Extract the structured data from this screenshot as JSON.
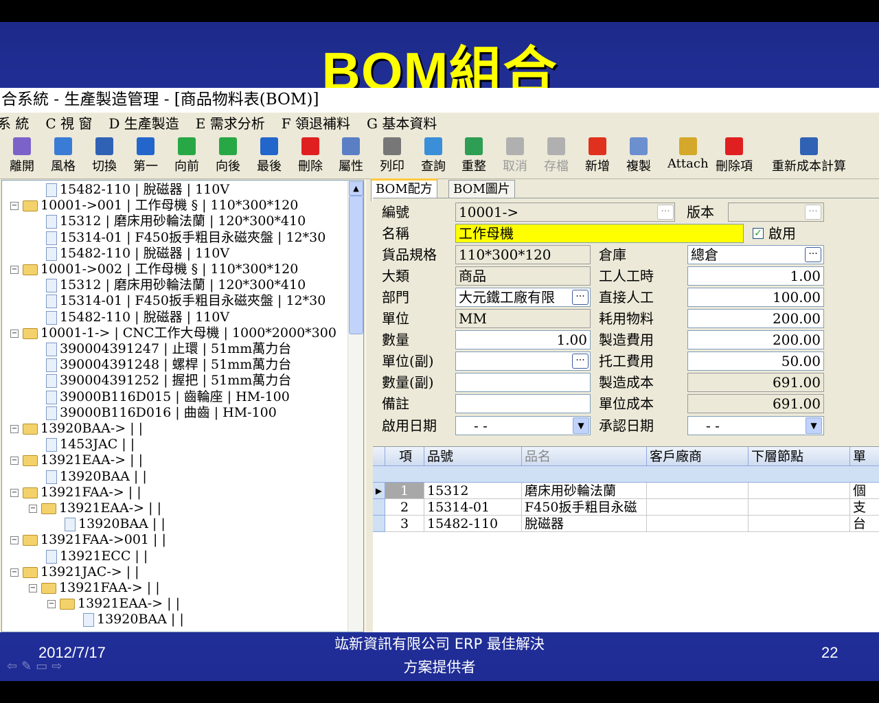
{
  "slide": {
    "title": "BOM組合",
    "footer_date": "2012/7/17",
    "footer_company_line1": "竑新資訊有限公司 ERP 最佳解決",
    "footer_company_line2": "方案提供者",
    "page_number": "22"
  },
  "window": {
    "title": "合系統 - 生產製造管理 - [商品物料表(BOM)]"
  },
  "menu": [
    "系 統",
    "C 視 窗",
    "D 生產製造",
    "E 需求分析",
    "F 領退補料",
    "G 基本資料"
  ],
  "toolbar": [
    {
      "label": "離開",
      "icon": "exit-icon",
      "color": "#7b62c9",
      "enabled": true
    },
    {
      "label": "風格",
      "icon": "window-style-icon",
      "color": "#3a7bd5",
      "enabled": true
    },
    {
      "label": "切換",
      "icon": "grid-switch-icon",
      "color": "#2f62b5",
      "enabled": true
    },
    {
      "label": "第一",
      "icon": "first-record-icon",
      "color": "#2266cc",
      "enabled": true
    },
    {
      "label": "向前",
      "icon": "prev-record-icon",
      "color": "#27a844",
      "enabled": true
    },
    {
      "label": "向後",
      "icon": "next-record-icon",
      "color": "#27a844",
      "enabled": true
    },
    {
      "label": "最後",
      "icon": "last-record-icon",
      "color": "#2266cc",
      "enabled": true
    },
    {
      "label": "刪除",
      "icon": "delete-icon",
      "color": "#e02020",
      "enabled": true
    },
    {
      "label": "屬性",
      "icon": "properties-icon",
      "color": "#5a7fc4",
      "enabled": true
    },
    {
      "label": "列印",
      "icon": "print-icon",
      "color": "#777777",
      "enabled": true
    },
    {
      "label": "查詢",
      "icon": "search-icon",
      "color": "#3a8fd8",
      "enabled": true
    },
    {
      "label": "重整",
      "icon": "refresh-icon",
      "color": "#2e9e54",
      "enabled": true
    },
    {
      "label": "取消",
      "icon": "undo-icon",
      "color": "#b0b0b0",
      "enabled": false
    },
    {
      "label": "存檔",
      "icon": "save-icon",
      "color": "#b0b0b0",
      "enabled": false
    },
    {
      "label": "新增",
      "icon": "add-icon",
      "color": "#e0301e",
      "enabled": true
    },
    {
      "label": "複製",
      "icon": "copy-icon",
      "color": "#6c8fcf",
      "enabled": true
    },
    {
      "label": "Attach",
      "icon": "attach-icon",
      "color": "#d4a82a",
      "enabled": true
    },
    {
      "label": "刪除項",
      "icon": "delete-item-icon",
      "color": "#e02020",
      "enabled": true
    },
    {
      "label": "重新成本計算",
      "icon": "recalculate-cost-icon",
      "color": "#2f62b5",
      "enabled": true
    }
  ],
  "tree": [
    {
      "indent": 2,
      "type": "doc",
      "label": "15482-110 | 脫磁器 | 110V"
    },
    {
      "indent": 0,
      "type": "folder",
      "label": "10001->001 | 工作母機 § | 110*300*120"
    },
    {
      "indent": 2,
      "type": "doc",
      "label": "15312 | 磨床用砂輪法蘭 | 120*300*410"
    },
    {
      "indent": 2,
      "type": "doc",
      "label": "15314-01 | F450扳手粗目永磁夾盤 | 12*30"
    },
    {
      "indent": 2,
      "type": "doc",
      "label": "15482-110 | 脫磁器 | 110V"
    },
    {
      "indent": 0,
      "type": "folder",
      "label": "10001->002 | 工作母機 § | 110*300*120"
    },
    {
      "indent": 2,
      "type": "doc",
      "label": "15312 | 磨床用砂輪法蘭 | 120*300*410"
    },
    {
      "indent": 2,
      "type": "doc",
      "label": "15314-01 | F450扳手粗目永磁夾盤 | 12*30"
    },
    {
      "indent": 2,
      "type": "doc",
      "label": "15482-110 | 脫磁器 | 110V"
    },
    {
      "indent": 0,
      "type": "folder",
      "label": "10001-1-> | CNC工作大母機 | 1000*2000*300"
    },
    {
      "indent": 2,
      "type": "doc",
      "label": "390004391247 | 止環 | 51mm萬力台"
    },
    {
      "indent": 2,
      "type": "doc",
      "label": "390004391248 | 螺桿 | 51mm萬力台"
    },
    {
      "indent": 2,
      "type": "doc",
      "label": "390004391252 | 握把 | 51mm萬力台"
    },
    {
      "indent": 2,
      "type": "doc",
      "label": "39000B116D015 | 齒輪座 | HM-100"
    },
    {
      "indent": 2,
      "type": "doc",
      "label": "39000B116D016 | 曲齒 | HM-100"
    },
    {
      "indent": 0,
      "type": "folder",
      "label": "13920BAA-> | |"
    },
    {
      "indent": 2,
      "type": "doc",
      "label": "1453JAC | |"
    },
    {
      "indent": 0,
      "type": "folder",
      "label": "13921EAA-> | |"
    },
    {
      "indent": 2,
      "type": "doc",
      "label": "13920BAA | |"
    },
    {
      "indent": 0,
      "type": "folder",
      "label": "13921FAA-> | |"
    },
    {
      "indent": 1,
      "type": "folder",
      "label": "13921EAA-> | |"
    },
    {
      "indent": 3,
      "type": "doc",
      "label": "13920BAA | |"
    },
    {
      "indent": 0,
      "type": "folder",
      "label": "13921FAA->001 | |"
    },
    {
      "indent": 2,
      "type": "doc",
      "label": "13921ECC | |"
    },
    {
      "indent": 0,
      "type": "folder",
      "label": "13921JAC-> | |"
    },
    {
      "indent": 1,
      "type": "folder",
      "label": "13921FAA-> | |"
    },
    {
      "indent": 2,
      "type": "folder",
      "label": "13921EAA-> | |"
    },
    {
      "indent": 4,
      "type": "doc",
      "label": "13920BAA | |"
    }
  ],
  "tabs": [
    "BOM配方",
    "BOM圖片"
  ],
  "form": {
    "code_label": "編號",
    "code_value": "10001->",
    "version_label": "版本",
    "version_value": "",
    "name_label": "名稱",
    "name_value": "工作母機",
    "enabled_label": "啟用",
    "enabled_checked": true,
    "spec_label": "貨品規格",
    "spec_value": "110*300*120",
    "warehouse_label": "倉庫",
    "warehouse_value": "總倉",
    "category_label": "大類",
    "category_value": "商品",
    "labor_hours_label": "工人工時",
    "labor_hours_value": "1.00",
    "dept_label": "部門",
    "dept_value": "大元鐵工廠有限",
    "direct_labor_label": "直接人工",
    "direct_labor_value": "100.00",
    "unit_label": "單位",
    "unit_value": "MM",
    "consumables_label": "耗用物料",
    "consumables_value": "200.00",
    "qty_label": "數量",
    "qty_value": "1.00",
    "mfg_expense_label": "製造費用",
    "mfg_expense_value": "200.00",
    "unit2_label": "單位(副)",
    "unit2_value": "",
    "outsource_label": "托工費用",
    "outsource_value": "50.00",
    "qty2_label": "數量(副)",
    "qty2_value": "",
    "mfg_cost_label": "製造成本",
    "mfg_cost_value": "691.00",
    "remark_label": "備註",
    "remark_value": "",
    "unit_cost_label": "單位成本",
    "unit_cost_value": "691.00",
    "start_date_label": "啟用日期",
    "start_date_value": "- -",
    "approve_date_label": "承認日期",
    "approve_date_value": "- -"
  },
  "grid": {
    "headers": [
      "項",
      "品號",
      "品名",
      "客戶廠商",
      "下層節點",
      "單"
    ],
    "rows": [
      [
        "1",
        "15312",
        "磨床用砂輪法蘭",
        "",
        "",
        "個"
      ],
      [
        "2",
        "15314-01",
        "F450扳手粗目永磁",
        "",
        "",
        "支"
      ],
      [
        "3",
        "15482-110",
        "脫磁器",
        "",
        "",
        "台"
      ]
    ]
  }
}
